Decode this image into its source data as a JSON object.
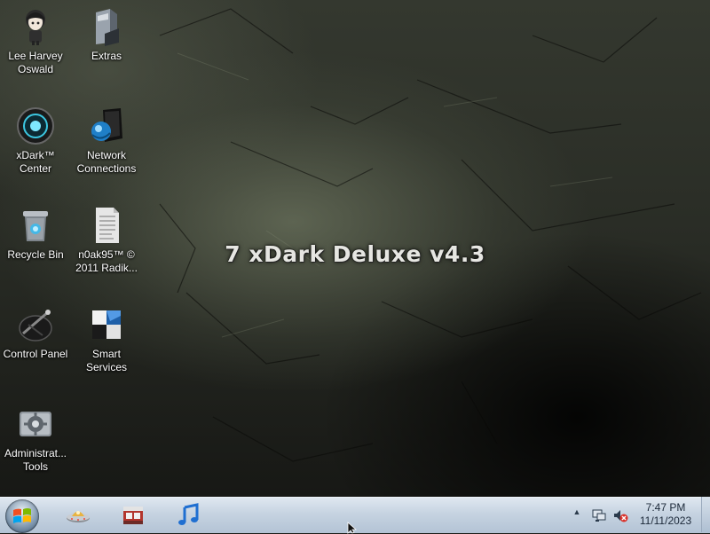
{
  "wallpaper": {
    "title": "7 xDark Deluxe v4.3"
  },
  "desktop_icons": [
    {
      "id": "lee-harvey-oswald",
      "label": "Lee Harvey\nOswald",
      "icon": "user-folder-icon"
    },
    {
      "id": "extras",
      "label": "Extras",
      "icon": "folder-icon"
    },
    {
      "id": "xdark-center",
      "label": "xDark™ Center",
      "icon": "xdark-center-icon"
    },
    {
      "id": "network-connections",
      "label": "Network\nConnections",
      "icon": "network-icon"
    },
    {
      "id": "recycle-bin",
      "label": "Recycle Bin",
      "icon": "recycle-bin-icon"
    },
    {
      "id": "n0ak95-document",
      "label": "n0ak95™ ©\n2011 Radik...",
      "icon": "document-icon"
    },
    {
      "id": "control-panel",
      "label": "Control Panel",
      "icon": "control-panel-icon"
    },
    {
      "id": "smart-services",
      "label": "Smart Services",
      "icon": "smart-services-icon"
    },
    {
      "id": "administrative-tools",
      "label": "Administrat...\nTools",
      "icon": "admin-tools-icon"
    }
  ],
  "taskbar": {
    "start_icon": "windows-logo-icon",
    "pinned": [
      {
        "id": "ufo-app",
        "icon": "ufo-icon"
      },
      {
        "id": "store-app",
        "icon": "store-icon"
      },
      {
        "id": "music-app",
        "icon": "music-note-icon"
      }
    ],
    "tray": {
      "chevron": "▲",
      "icons": [
        "network-tray-icon",
        "volume-muted-icon"
      ]
    },
    "clock": {
      "time": "7:47 PM",
      "date": "11/11/2023"
    }
  }
}
